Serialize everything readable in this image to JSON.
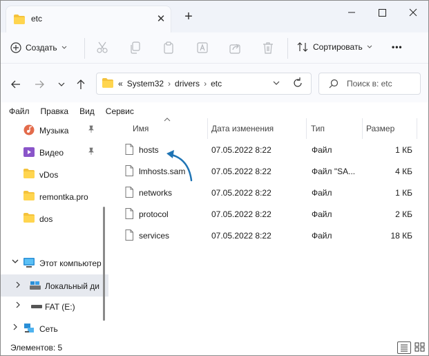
{
  "window": {
    "tab_title": "etc",
    "new_tab": "+",
    "close_tab": "✕",
    "minimize": "—",
    "maximize": "☐",
    "close": "✕"
  },
  "toolbar": {
    "create_label": "Создать",
    "sort_label": "Сортировать",
    "more_label": "•••"
  },
  "address": {
    "overflow": "«",
    "crumbs": [
      "System32",
      "drivers",
      "etc"
    ],
    "separator": "›"
  },
  "search": {
    "placeholder": "Поиск в: etc"
  },
  "menu": {
    "items": [
      "Файл",
      "Правка",
      "Вид",
      "Сервис"
    ]
  },
  "sidebar": {
    "items": [
      {
        "label": "Музыка",
        "icon": "music-icon",
        "pinned": true
      },
      {
        "label": "Видео",
        "icon": "video-icon",
        "pinned": true
      },
      {
        "label": "vDos",
        "icon": "folder-icon",
        "pinned": false
      },
      {
        "label": "remontka.pro",
        "icon": "folder-icon",
        "pinned": false
      },
      {
        "label": "dos",
        "icon": "folder-icon",
        "pinned": false
      },
      {
        "label": "Этот компьютер",
        "icon": "computer-icon",
        "expanded": true
      },
      {
        "label": "Локальный ди",
        "icon": "drive-icon",
        "selected": true
      },
      {
        "label": "FAT (E:)",
        "icon": "drive-icon"
      },
      {
        "label": "Сеть",
        "icon": "network-icon"
      }
    ]
  },
  "columns": {
    "name": "Имя",
    "date": "Дата изменения",
    "type": "Тип",
    "size": "Размер"
  },
  "files": [
    {
      "name": "hosts",
      "date": "07.05.2022 8:22",
      "type": "Файл",
      "size": "1 КБ"
    },
    {
      "name": "lmhosts.sam",
      "date": "07.05.2022 8:22",
      "type": "Файл \"SA...",
      "size": "4 КБ"
    },
    {
      "name": "networks",
      "date": "07.05.2022 8:22",
      "type": "Файл",
      "size": "1 КБ"
    },
    {
      "name": "protocol",
      "date": "07.05.2022 8:22",
      "type": "Файл",
      "size": "2 КБ"
    },
    {
      "name": "services",
      "date": "07.05.2022 8:22",
      "type": "Файл",
      "size": "18 КБ"
    }
  ],
  "status": {
    "items_count": "Элементов: 5"
  },
  "colors": {
    "accent": "#1a6fb8",
    "folder": "#f4c23c",
    "arrow": "#1f74b4"
  }
}
